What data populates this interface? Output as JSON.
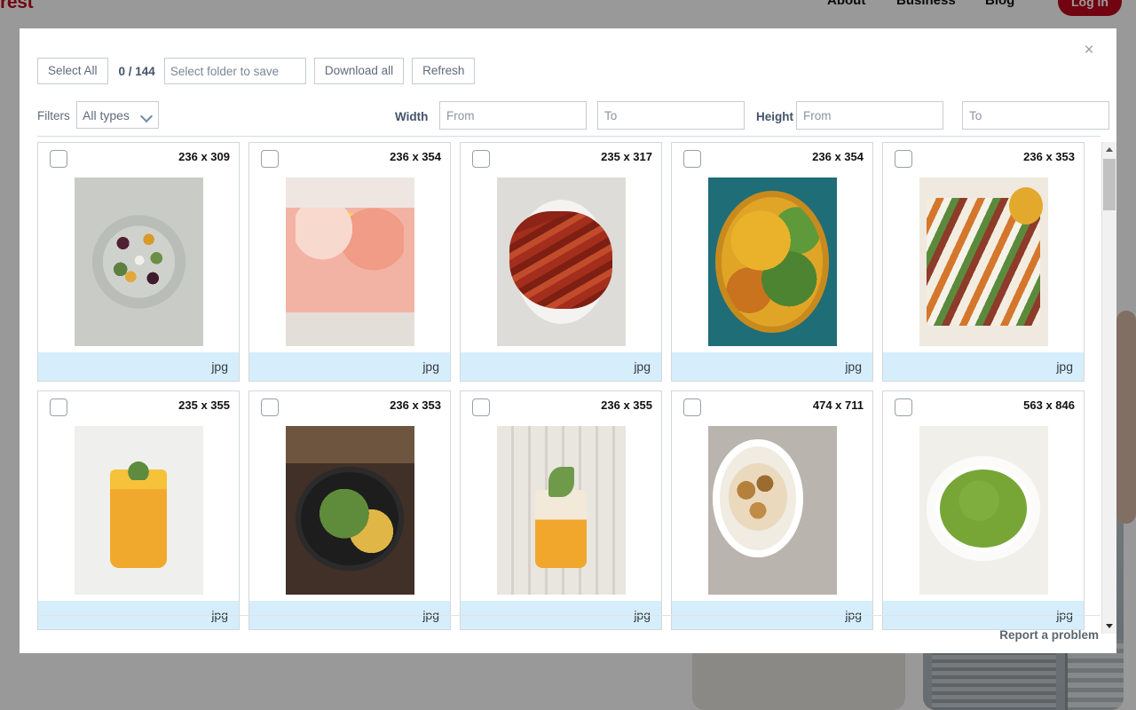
{
  "background": {
    "logo_text": "rest",
    "nav": [
      {
        "label": "About"
      },
      {
        "label": "Business"
      },
      {
        "label": "Blog"
      }
    ],
    "login_label": "Log in",
    "overlay_color": "#000000"
  },
  "modal": {
    "close_label": "×",
    "toolbar": {
      "select_all_label": "Select All",
      "counter": "0 / 144",
      "folder_value": "",
      "folder_placeholder": "Select folder to save",
      "download_all_label": "Download all",
      "refresh_label": "Refresh"
    },
    "filters": {
      "filters_label": "Filters",
      "type_selected": "All types",
      "type_options": [
        "All types"
      ],
      "width_label": "Width",
      "height_label": "Height",
      "width_from_value": "",
      "width_from_placeholder": "From",
      "width_to_value": "",
      "width_to_placeholder": "To",
      "height_from_value": "",
      "height_from_placeholder": "From",
      "height_to_value": "",
      "height_to_placeholder": "To"
    },
    "grid": {
      "items": [
        {
          "dimensions": "236 x 309",
          "ext": "jpg",
          "checked": false,
          "thumb_class": "t1"
        },
        {
          "dimensions": "236 x 354",
          "ext": "jpg",
          "checked": false,
          "thumb_class": "t2"
        },
        {
          "dimensions": "235 x 317",
          "ext": "jpg",
          "checked": false,
          "thumb_class": "t3"
        },
        {
          "dimensions": "236 x 354",
          "ext": "jpg",
          "checked": false,
          "thumb_class": "t4"
        },
        {
          "dimensions": "236 x 353",
          "ext": "jpg",
          "checked": false,
          "thumb_class": "t5"
        },
        {
          "dimensions": "235 x 355",
          "ext": "jpg",
          "checked": false,
          "thumb_class": "t6"
        },
        {
          "dimensions": "236 x 353",
          "ext": "jpg",
          "checked": false,
          "thumb_class": "t7"
        },
        {
          "dimensions": "236 x 355",
          "ext": "jpg",
          "checked": false,
          "thumb_class": "t8"
        },
        {
          "dimensions": "474 x 711",
          "ext": "jpg",
          "checked": false,
          "thumb_class": "t9"
        },
        {
          "dimensions": "563 x 846",
          "ext": "jpg",
          "checked": false,
          "thumb_class": "t10"
        }
      ],
      "footer_bar_color": "#d6eefb"
    },
    "footer": {
      "report_label": "Report a problem"
    },
    "scrollbar": {
      "up_arrow": "▲",
      "down_arrow": "▼"
    }
  }
}
